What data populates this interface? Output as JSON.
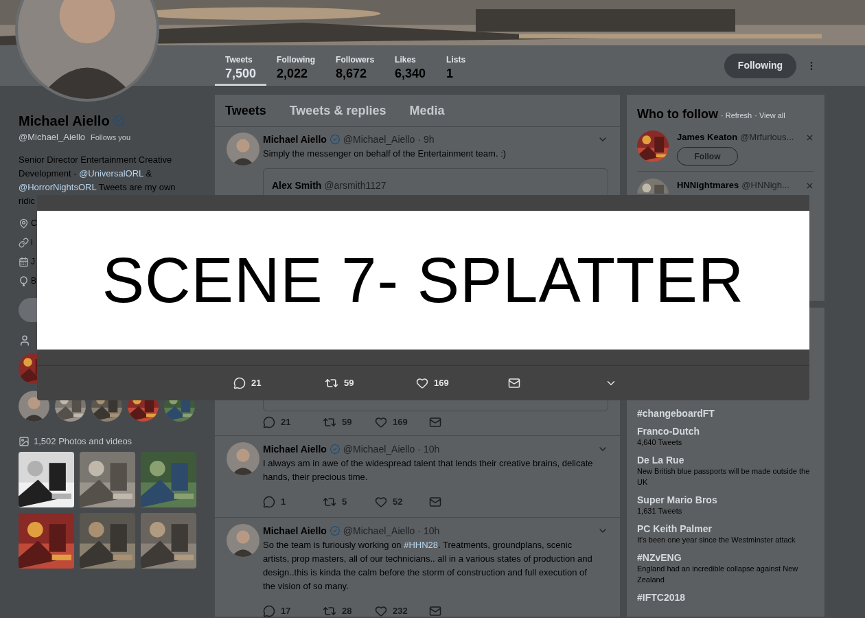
{
  "profile": {
    "name": "Michael Aiello",
    "handle": "@Michael_Aiello",
    "follows_you": "Follows you",
    "bio": [
      {
        "kind": "text",
        "text": "Senior Director Entertainment Creative Development - "
      },
      {
        "kind": "link",
        "text": "@UniversalORL"
      },
      {
        "kind": "text",
        "text": " & "
      },
      {
        "kind": "link",
        "text": "@HorrorNightsORL"
      },
      {
        "kind": "text",
        "text": " Tweets are my own ridic"
      }
    ],
    "details": [
      {
        "kind": "location",
        "text": "C"
      },
      {
        "kind": "link",
        "text": "i"
      },
      {
        "kind": "joined",
        "text": "J"
      },
      {
        "kind": "birthday",
        "text": "B"
      }
    ],
    "photos_label": "1,502 Photos and videos"
  },
  "stats": [
    {
      "label": "Tweets",
      "value": "7,500",
      "selected": true
    },
    {
      "label": "Following",
      "value": "2,022",
      "selected": false
    },
    {
      "label": "Followers",
      "value": "8,672",
      "selected": false
    },
    {
      "label": "Likes",
      "value": "6,340",
      "selected": false
    },
    {
      "label": "Lists",
      "value": "1",
      "selected": false
    }
  ],
  "follow_button": "Following",
  "tabs": [
    {
      "label": "Tweets",
      "selected": true
    },
    {
      "label": "Tweets & replies",
      "selected": false
    },
    {
      "label": "Media",
      "selected": false
    }
  ],
  "tweets": [
    {
      "name": "Michael Aiello",
      "handle": "@Michael_Aiello",
      "time": "· 9h",
      "text": [
        {
          "kind": "text",
          "text": "Simply the messenger on behalf of the Entertainment team. :)"
        }
      ],
      "quote": {
        "name": "Alex Smith",
        "handle": "@arsmith1127"
      },
      "replies": "21",
      "retweets": "59",
      "likes": "169"
    },
    {
      "name": "Michael Aiello",
      "handle": "@Michael_Aiello",
      "time": "· 10h",
      "text": [
        {
          "kind": "text",
          "text": "I always am in awe of the widespread talent that lends their creative brains, delicate hands, their precious time."
        }
      ],
      "replies": "1",
      "retweets": "5",
      "likes": "52"
    },
    {
      "name": "Michael Aiello",
      "handle": "@Michael_Aiello",
      "time": "· 10h",
      "text": [
        {
          "kind": "text",
          "text": "So the team is furiously working on "
        },
        {
          "kind": "link",
          "text": "#HHN28"
        },
        {
          "kind": "text",
          "text": ". Treatments, groundplans, scenic artists, prop masters, all of our technicians.. all in a various states of production and design..this is kinda the calm before the storm of construction and full execution of the vision of so many."
        }
      ],
      "replies": "17",
      "retweets": "28",
      "likes": "232"
    }
  ],
  "who_to_follow": {
    "title": "Who to follow",
    "links": [
      "· Refresh",
      "· View all"
    ],
    "accounts": [
      {
        "name": "James Keaton",
        "handle": "@Mrfurious...",
        "button": "Follow"
      },
      {
        "name": "HNNightmares",
        "handle": "@HNNigh..."
      }
    ]
  },
  "trends": [
    {
      "name": "#changeboardFT"
    },
    {
      "name": "Franco-Dutch",
      "meta": "4,640 Tweets"
    },
    {
      "name": "De La Rue",
      "meta": "New British blue passports will be made outside the UK"
    },
    {
      "name": "Super Mario Bros",
      "meta": "1,631 Tweets"
    },
    {
      "name": "PC Keith Palmer",
      "meta": "It's been one year since the Westminster attack"
    },
    {
      "name": "#NZvENG",
      "meta": "England had an incredible collapse against New Zealand"
    },
    {
      "name": "#IFTC2018"
    }
  ],
  "modal": {
    "image_text": "SCENE 7- SPLATTER",
    "replies": "21",
    "retweets": "59",
    "likes": "169"
  }
}
